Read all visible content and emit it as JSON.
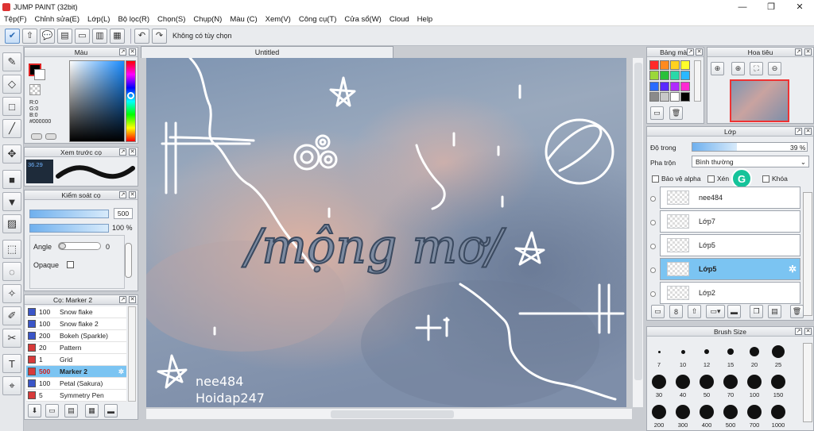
{
  "window": {
    "title": "JUMP PAINT (32bit)"
  },
  "menu": [
    "Tệp(F)",
    "Chỉnh sửa(E)",
    "Lớp(L)",
    "Bộ lọc(R)",
    "Chọn(S)",
    "Chụp(N)",
    "Màu (C)",
    "Xem(V)",
    "Công cụ(T)",
    "Cửa sổ(W)",
    "Cloud",
    "Help"
  ],
  "toolbar": {
    "no_option": "Không có tùy chọn"
  },
  "color_panel": {
    "title": "Màu",
    "r": "R:0",
    "g": "G:0",
    "b": "B:0",
    "hex": "#000000"
  },
  "brush_preview": {
    "title": "Xem trước cọ",
    "size": "36.29"
  },
  "brush_control": {
    "title": "Kiểm soát cọ",
    "size": "500",
    "opacity": "100 %",
    "angle_label": "Angle",
    "angle_value": "0",
    "opaque_label": "Opaque"
  },
  "brush_list": {
    "title": "Cọ: Marker 2",
    "items": [
      {
        "size": "100",
        "name": "Snow flake",
        "color": "#3a55c8"
      },
      {
        "size": "100",
        "name": "Snow flake 2",
        "color": "#3a55c8"
      },
      {
        "size": "200",
        "name": "Bokeh (Sparkle)",
        "color": "#3a55c8"
      },
      {
        "size": "20",
        "name": "Pattern",
        "color": "#d83a3a"
      },
      {
        "size": "1",
        "name": "Grid",
        "color": "#d83a3a"
      },
      {
        "size": "500",
        "name": "Marker 2",
        "color": "#d83a3a",
        "selected": true
      },
      {
        "size": "100",
        "name": "Petal (Sakura)",
        "color": "#3a55c8"
      },
      {
        "size": "5",
        "name": "Symmetry Pen",
        "color": "#d83a3a"
      }
    ]
  },
  "document": {
    "tab": "Untitled"
  },
  "canvas_text": {
    "main": "/mộng mơ/",
    "credit1": "nee484",
    "credit2": "Hoidap247"
  },
  "palette": {
    "title": "Bảng màu",
    "colors": [
      "#ff2a2a",
      "#ff8a1e",
      "#ffd21e",
      "#ffff2a",
      "#9bd83a",
      "#2ac03a",
      "#2ad8a8",
      "#2ab8ff",
      "#2a6aff",
      "#5a2aff",
      "#b02aff",
      "#ff2ad2",
      "#8a8a8a",
      "#c8c8c8",
      "#ffffff",
      "#000000"
    ]
  },
  "navigator": {
    "title": "Hoa tiêu"
  },
  "layers": {
    "title": "Lớp",
    "opacity_label": "Độ trong",
    "opacity_value": "39 %",
    "blend_label": "Pha trộn",
    "blend_value": "Bình thường",
    "protect_alpha": "Bảo vệ alpha",
    "clip": "Xén",
    "lock": "Khóa",
    "items": [
      {
        "name": "nee484"
      },
      {
        "name": "Lớp7"
      },
      {
        "name": "Lớp5"
      },
      {
        "name": "Lớp5",
        "selected": true
      },
      {
        "name": "Lớp2"
      }
    ]
  },
  "brush_size": {
    "title": "Brush Size",
    "labels": [
      "7",
      "10",
      "12",
      "15",
      "20",
      "25",
      "30",
      "40",
      "50",
      "70",
      "100",
      "150",
      "200",
      "300",
      "400",
      "500",
      "700",
      "1000"
    ]
  }
}
